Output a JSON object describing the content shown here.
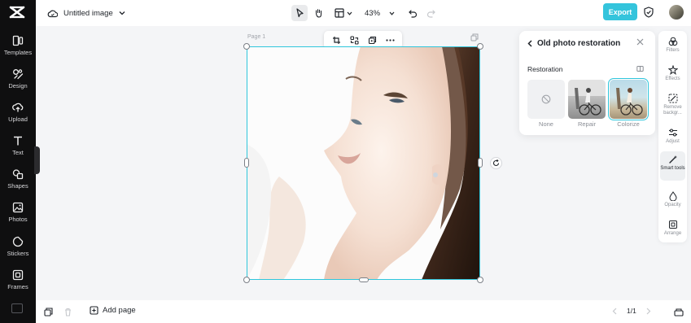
{
  "app": {
    "title": "Untitled image"
  },
  "rail": {
    "items": [
      {
        "label": "Templates",
        "icon": "templates-icon"
      },
      {
        "label": "Design",
        "icon": "design-icon"
      },
      {
        "label": "Upload",
        "icon": "upload-icon"
      },
      {
        "label": "Text",
        "icon": "text-icon"
      },
      {
        "label": "Shapes",
        "icon": "shapes-icon"
      },
      {
        "label": "Photos",
        "icon": "photos-icon"
      },
      {
        "label": "Stickers",
        "icon": "stickers-icon"
      },
      {
        "label": "Frames",
        "icon": "frames-icon"
      }
    ]
  },
  "toolbar": {
    "zoom": "43%",
    "export_label": "Export"
  },
  "canvas": {
    "page_label": "Page 1"
  },
  "panel": {
    "title": "Old photo restoration",
    "section_title": "Restoration",
    "options": [
      {
        "label": "None"
      },
      {
        "label": "Repair"
      },
      {
        "label": "Colorize",
        "selected": true
      }
    ]
  },
  "right_tools": {
    "items": [
      {
        "label": "Filters"
      },
      {
        "label": "Effects"
      },
      {
        "label": "Remove backgr..."
      },
      {
        "label": "Adjust"
      },
      {
        "label": "Smart tools",
        "active": true
      },
      {
        "label": "Opacity"
      },
      {
        "label": "Arrange"
      }
    ]
  },
  "bottom": {
    "add_page_label": "Add page",
    "page_indicator": "1/1"
  },
  "colors": {
    "accent": "#34c4dc",
    "selection": "#2fc6dc",
    "rail_bg": "#0f0f10"
  }
}
